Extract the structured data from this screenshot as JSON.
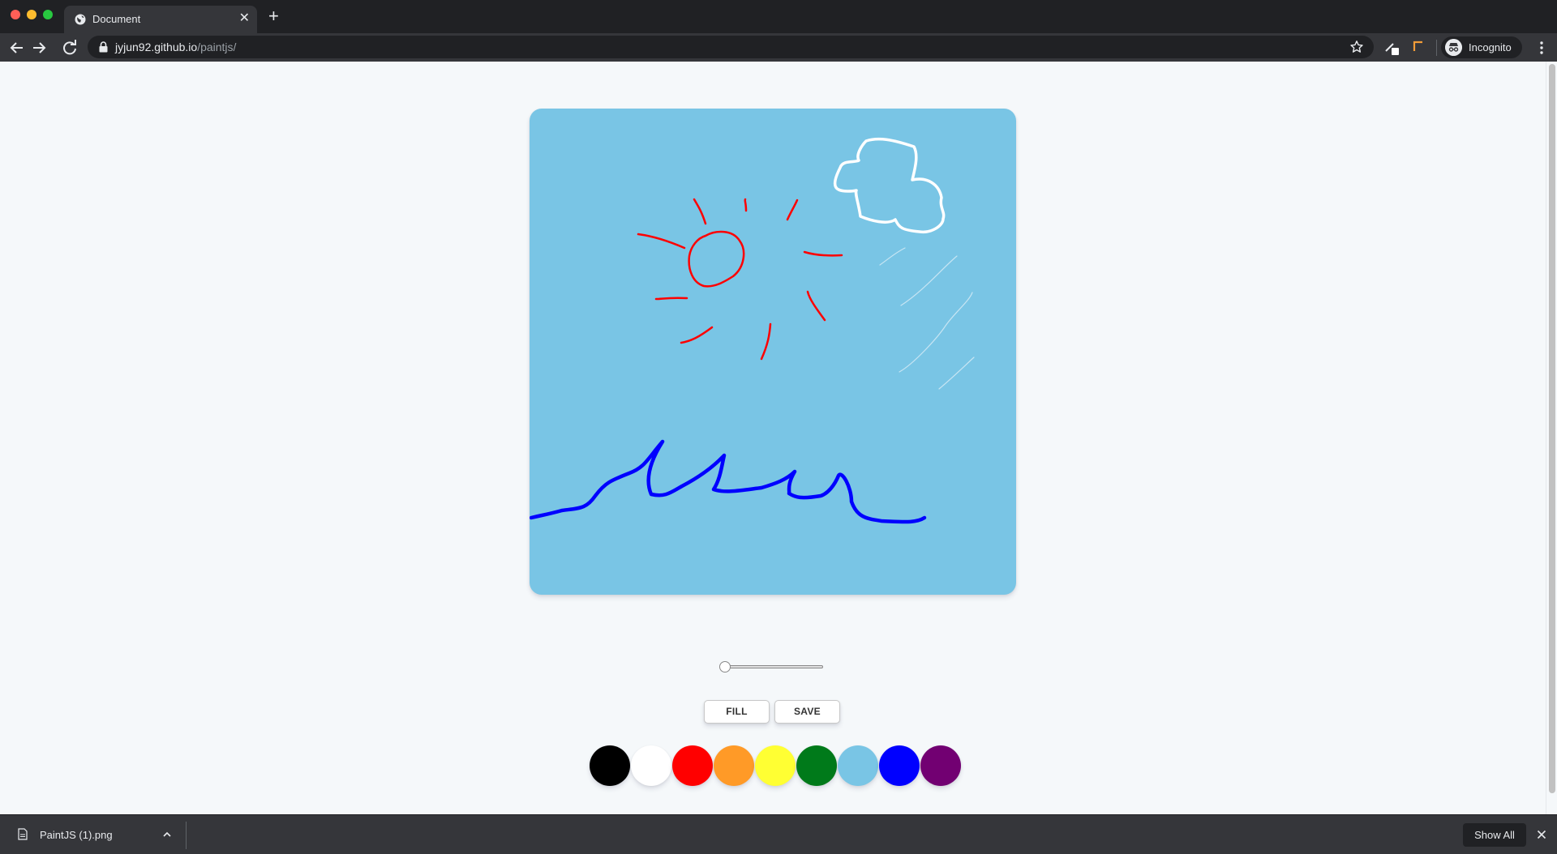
{
  "browser": {
    "tab": {
      "title": "Document",
      "close_glyph": "✕",
      "favicon": "globe-icon"
    },
    "new_tab_glyph": "+",
    "url": {
      "host": "jyjun92.github.io",
      "path": "/paintjs/"
    },
    "profile": {
      "label": "Incognito",
      "icon": "incognito-icon"
    }
  },
  "paint": {
    "canvas": {
      "background": "#79c5e5"
    },
    "brush_range": {
      "min": 0.1,
      "max": 5.0,
      "value": 0.1
    },
    "buttons": {
      "fill": "FILL",
      "save": "SAVE"
    },
    "colors": [
      {
        "name": "black",
        "hex": "#000000"
      },
      {
        "name": "white",
        "hex": "#ffffff"
      },
      {
        "name": "red",
        "hex": "#ff0000"
      },
      {
        "name": "orange",
        "hex": "#ff9a27"
      },
      {
        "name": "yellow",
        "hex": "#ffff33"
      },
      {
        "name": "green",
        "hex": "#007a1a"
      },
      {
        "name": "skyblue",
        "hex": "#79c5e5"
      },
      {
        "name": "blue",
        "hex": "#0000ff"
      },
      {
        "name": "purple",
        "hex": "#720072"
      }
    ]
  },
  "downloads": {
    "file_name": "PaintJS (1).png",
    "show_all": "Show All"
  }
}
